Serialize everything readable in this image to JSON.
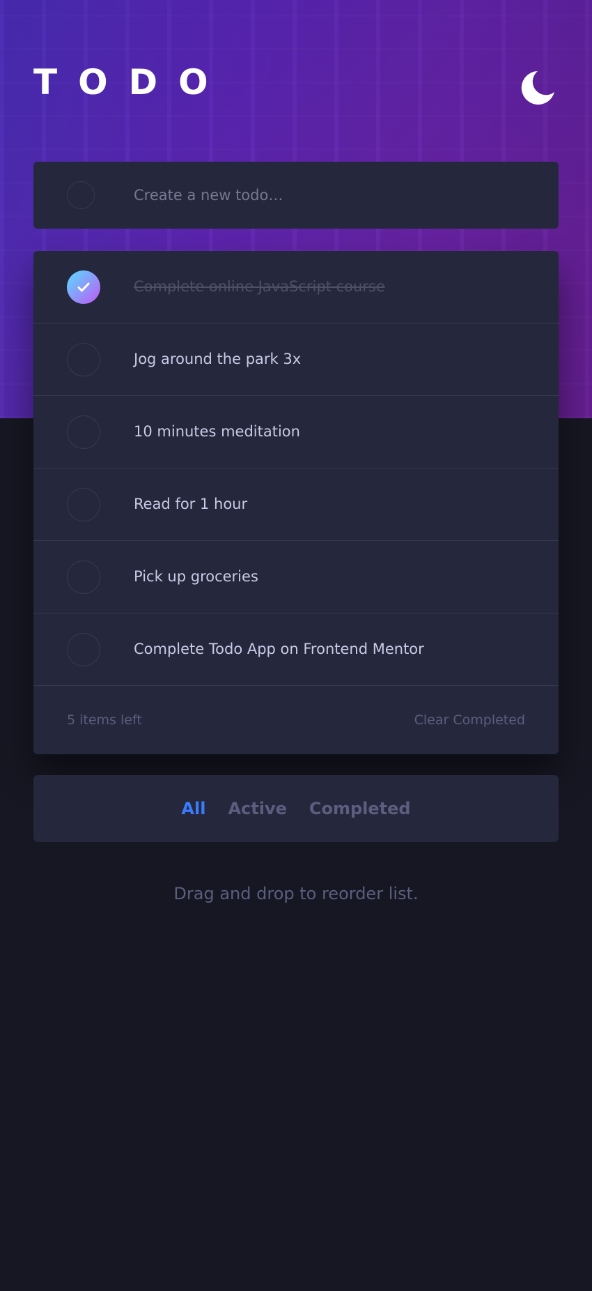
{
  "header": {
    "title": "TODO",
    "theme_icon": "moon-icon"
  },
  "new_todo": {
    "placeholder": "Create a new todo…"
  },
  "todos": [
    {
      "label": "Complete online JavaScript course",
      "completed": true
    },
    {
      "label": "Jog around the park 3x",
      "completed": false
    },
    {
      "label": "10 minutes meditation",
      "completed": false
    },
    {
      "label": "Read for 1 hour",
      "completed": false
    },
    {
      "label": "Pick up groceries",
      "completed": false
    },
    {
      "label": "Complete Todo App on Frontend Mentor",
      "completed": false
    }
  ],
  "footer": {
    "items_left": "5 items left",
    "clear_label": "Clear Completed"
  },
  "filters": {
    "all": "All",
    "active": "Active",
    "completed": "Completed",
    "selected": "all"
  },
  "hint": "Drag and drop to reorder list.",
  "colors": {
    "accent": "#3a7cfd",
    "check_gradient_start": "#57ddff",
    "check_gradient_end": "#c058f3",
    "card_background": "#25273c",
    "page_background": "#161722"
  }
}
